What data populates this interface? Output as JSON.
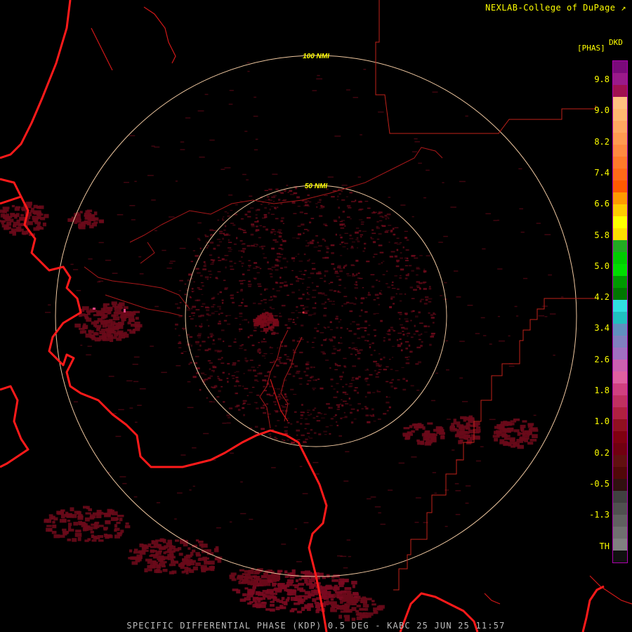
{
  "header": {
    "credit": "NEXLAB-College of DuPage",
    "credit_icon": "resize-corner-icon"
  },
  "footer": {
    "caption": "SPECIFIC DIFFERENTIAL PHASE (KDP) 0.5 DEG - KABC 25 JUN 25 11:57"
  },
  "rings": [
    {
      "label": "100 NMI"
    },
    {
      "label": "50 NMI"
    }
  ],
  "legend": {
    "product": "DKD",
    "units": "[PHAS]",
    "ticks": [
      "9.8",
      "9.0",
      "8.2",
      "7.4",
      "6.6",
      "5.8",
      "5.0",
      "4.2",
      "3.4",
      "2.6",
      "1.8",
      "1.0",
      "0.2",
      "-0.5",
      "-1.3",
      "TH"
    ],
    "colors": [
      "#7a0a7a",
      "#9a1a8a",
      "#a01050",
      "#ffc080",
      "#ffb870",
      "#ffa860",
      "#ff9a50",
      "#ff8a40",
      "#ff7a2a",
      "#ff6a18",
      "#ff5a00",
      "#ff9a00",
      "#ffcc00",
      "#ffff00",
      "#ffe000",
      "#22aa22",
      "#00cc00",
      "#00dd00",
      "#009900",
      "#007700",
      "#30e0e0",
      "#20c0c0",
      "#6090c0",
      "#8080c0",
      "#a070c0",
      "#cc60b0",
      "#e060a0",
      "#d04080",
      "#c03060",
      "#b02040",
      "#901020",
      "#800010",
      "#700010",
      "#601010",
      "#500808",
      "#301010",
      "#404040",
      "#505050",
      "#606060",
      "#707070",
      "#808080",
      "#101010"
    ]
  },
  "colors": {
    "reflectivity": "#6a0a1a",
    "state_border": "#c0221a",
    "coastline": "#ff1a1a",
    "county_line": "#b01a1a",
    "range_ring": "#f0c8a0",
    "ring_label": "#ffff00"
  }
}
